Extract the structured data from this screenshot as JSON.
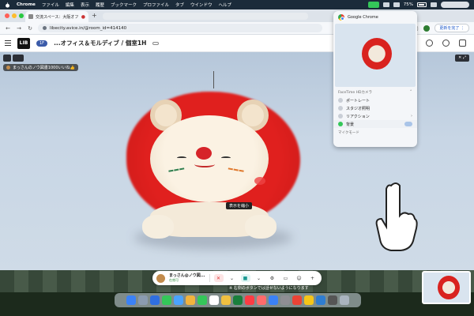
{
  "menubar": {
    "app": "Chrome",
    "items": [
      "ファイル",
      "編集",
      "表示",
      "履歴",
      "ブックマーク",
      "プロファイル",
      "タブ",
      "ウインドウ",
      "ヘルプ"
    ],
    "battery": "75%"
  },
  "browser": {
    "tab_title": "交流スペース：大阪オフィ",
    "url": "libecity.avice.in/@room_id=414140",
    "update_label": "更新を完了 ⋮"
  },
  "app_header": {
    "logo_text": "LIB",
    "floor": "1F",
    "room_title": "...オフィス＆モルディブ / 個室1H"
  },
  "stage": {
    "name_chip": "まっさんのノウ図書1000いいね👍",
    "tooltip": "表示を縮小"
  },
  "popover": {
    "app_name": "Google Chrome",
    "section_label": "FaceTime HDカメラ",
    "items": [
      {
        "label": "ポートレート",
        "icon": "portrait-icon"
      },
      {
        "label": "スタジオ照明",
        "icon": "studio-light-icon"
      },
      {
        "label": "リアクション",
        "icon": "reaction-icon"
      },
      {
        "label": "背景",
        "icon": "background-icon"
      }
    ],
    "footer": "マイクモード"
  },
  "controls": {
    "user_name": "まっさん@ノウ図...",
    "user_status": "在席可"
  },
  "notice": "※ 右側のボタンでは話せないようになります",
  "colors": {
    "accent": "#3b5ba9",
    "mic_off": "#d33333",
    "camera": "#1a9a92",
    "facetime_green": "#34c759"
  }
}
